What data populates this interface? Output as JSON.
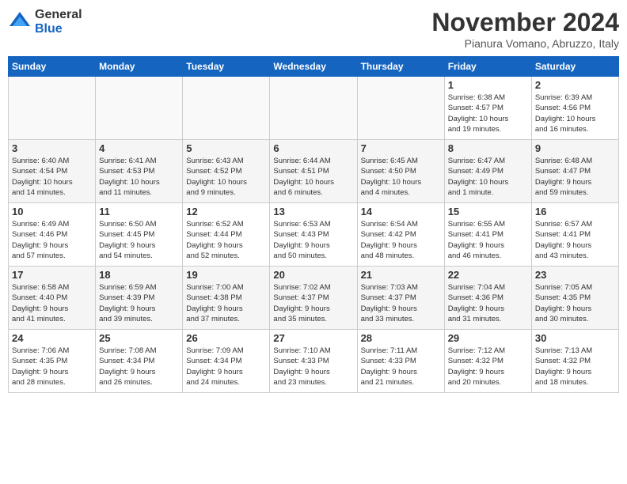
{
  "header": {
    "logo_general": "General",
    "logo_blue": "Blue",
    "month_title": "November 2024",
    "location": "Pianura Vomano, Abruzzo, Italy"
  },
  "weekdays": [
    "Sunday",
    "Monday",
    "Tuesday",
    "Wednesday",
    "Thursday",
    "Friday",
    "Saturday"
  ],
  "weeks": [
    [
      {
        "day": "",
        "detail": ""
      },
      {
        "day": "",
        "detail": ""
      },
      {
        "day": "",
        "detail": ""
      },
      {
        "day": "",
        "detail": ""
      },
      {
        "day": "",
        "detail": ""
      },
      {
        "day": "1",
        "detail": "Sunrise: 6:38 AM\nSunset: 4:57 PM\nDaylight: 10 hours\nand 19 minutes."
      },
      {
        "day": "2",
        "detail": "Sunrise: 6:39 AM\nSunset: 4:56 PM\nDaylight: 10 hours\nand 16 minutes."
      }
    ],
    [
      {
        "day": "3",
        "detail": "Sunrise: 6:40 AM\nSunset: 4:54 PM\nDaylight: 10 hours\nand 14 minutes."
      },
      {
        "day": "4",
        "detail": "Sunrise: 6:41 AM\nSunset: 4:53 PM\nDaylight: 10 hours\nand 11 minutes."
      },
      {
        "day": "5",
        "detail": "Sunrise: 6:43 AM\nSunset: 4:52 PM\nDaylight: 10 hours\nand 9 minutes."
      },
      {
        "day": "6",
        "detail": "Sunrise: 6:44 AM\nSunset: 4:51 PM\nDaylight: 10 hours\nand 6 minutes."
      },
      {
        "day": "7",
        "detail": "Sunrise: 6:45 AM\nSunset: 4:50 PM\nDaylight: 10 hours\nand 4 minutes."
      },
      {
        "day": "8",
        "detail": "Sunrise: 6:47 AM\nSunset: 4:49 PM\nDaylight: 10 hours\nand 1 minute."
      },
      {
        "day": "9",
        "detail": "Sunrise: 6:48 AM\nSunset: 4:47 PM\nDaylight: 9 hours\nand 59 minutes."
      }
    ],
    [
      {
        "day": "10",
        "detail": "Sunrise: 6:49 AM\nSunset: 4:46 PM\nDaylight: 9 hours\nand 57 minutes."
      },
      {
        "day": "11",
        "detail": "Sunrise: 6:50 AM\nSunset: 4:45 PM\nDaylight: 9 hours\nand 54 minutes."
      },
      {
        "day": "12",
        "detail": "Sunrise: 6:52 AM\nSunset: 4:44 PM\nDaylight: 9 hours\nand 52 minutes."
      },
      {
        "day": "13",
        "detail": "Sunrise: 6:53 AM\nSunset: 4:43 PM\nDaylight: 9 hours\nand 50 minutes."
      },
      {
        "day": "14",
        "detail": "Sunrise: 6:54 AM\nSunset: 4:42 PM\nDaylight: 9 hours\nand 48 minutes."
      },
      {
        "day": "15",
        "detail": "Sunrise: 6:55 AM\nSunset: 4:41 PM\nDaylight: 9 hours\nand 46 minutes."
      },
      {
        "day": "16",
        "detail": "Sunrise: 6:57 AM\nSunset: 4:41 PM\nDaylight: 9 hours\nand 43 minutes."
      }
    ],
    [
      {
        "day": "17",
        "detail": "Sunrise: 6:58 AM\nSunset: 4:40 PM\nDaylight: 9 hours\nand 41 minutes."
      },
      {
        "day": "18",
        "detail": "Sunrise: 6:59 AM\nSunset: 4:39 PM\nDaylight: 9 hours\nand 39 minutes."
      },
      {
        "day": "19",
        "detail": "Sunrise: 7:00 AM\nSunset: 4:38 PM\nDaylight: 9 hours\nand 37 minutes."
      },
      {
        "day": "20",
        "detail": "Sunrise: 7:02 AM\nSunset: 4:37 PM\nDaylight: 9 hours\nand 35 minutes."
      },
      {
        "day": "21",
        "detail": "Sunrise: 7:03 AM\nSunset: 4:37 PM\nDaylight: 9 hours\nand 33 minutes."
      },
      {
        "day": "22",
        "detail": "Sunrise: 7:04 AM\nSunset: 4:36 PM\nDaylight: 9 hours\nand 31 minutes."
      },
      {
        "day": "23",
        "detail": "Sunrise: 7:05 AM\nSunset: 4:35 PM\nDaylight: 9 hours\nand 30 minutes."
      }
    ],
    [
      {
        "day": "24",
        "detail": "Sunrise: 7:06 AM\nSunset: 4:35 PM\nDaylight: 9 hours\nand 28 minutes."
      },
      {
        "day": "25",
        "detail": "Sunrise: 7:08 AM\nSunset: 4:34 PM\nDaylight: 9 hours\nand 26 minutes."
      },
      {
        "day": "26",
        "detail": "Sunrise: 7:09 AM\nSunset: 4:34 PM\nDaylight: 9 hours\nand 24 minutes."
      },
      {
        "day": "27",
        "detail": "Sunrise: 7:10 AM\nSunset: 4:33 PM\nDaylight: 9 hours\nand 23 minutes."
      },
      {
        "day": "28",
        "detail": "Sunrise: 7:11 AM\nSunset: 4:33 PM\nDaylight: 9 hours\nand 21 minutes."
      },
      {
        "day": "29",
        "detail": "Sunrise: 7:12 AM\nSunset: 4:32 PM\nDaylight: 9 hours\nand 20 minutes."
      },
      {
        "day": "30",
        "detail": "Sunrise: 7:13 AM\nSunset: 4:32 PM\nDaylight: 9 hours\nand 18 minutes."
      }
    ]
  ]
}
